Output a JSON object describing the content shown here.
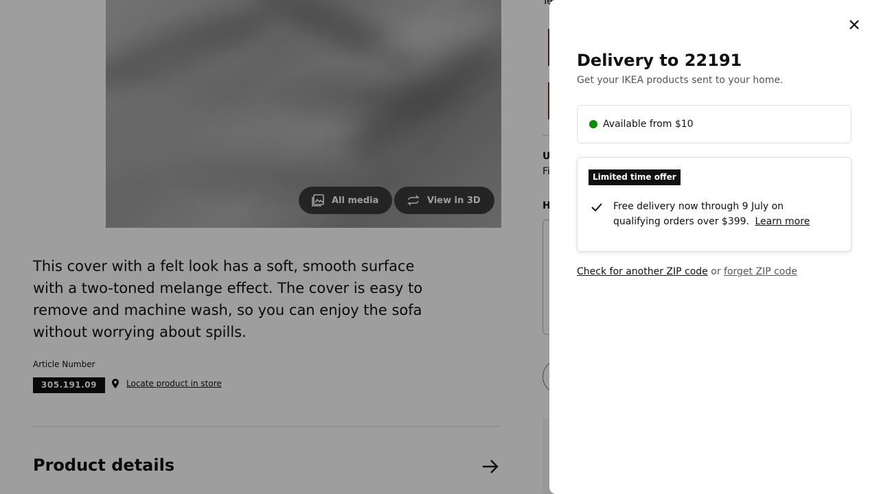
{
  "product": {
    "media_buttons": {
      "all_media": "All media",
      "view_3d": "View in 3D"
    },
    "description": "This cover with a felt look has a soft, smooth surface with a two-toned melange effect. The cover is easy to remove and machine wash, so you can enjoy the sofa without worrying about spills.",
    "article_label": "Article Number",
    "article_number": "305.191.09",
    "locate_link": "Locate product in store",
    "details_heading": "Product details",
    "right_column": {
      "top_text": "Te",
      "u_text": "U",
      "fi_text": "Fi",
      "h_text": "H",
      "swatch_colors": [
        "#8b2a22",
        "#7a3a1c"
      ]
    }
  },
  "delivery_panel": {
    "title": "Delivery to 22191",
    "subtitle": "Get your IKEA products sent to your home.",
    "availability": {
      "text": "Available from $10",
      "status_color": "#0a8a00"
    },
    "offer": {
      "badge": "Limited time offer",
      "text": "Free delivery now through 9 July on qualifying orders over $399.",
      "link": "Learn more"
    },
    "zip": {
      "check_link": "Check for another ZIP code",
      "or": "or",
      "forget_link": "forget ZIP code"
    }
  }
}
